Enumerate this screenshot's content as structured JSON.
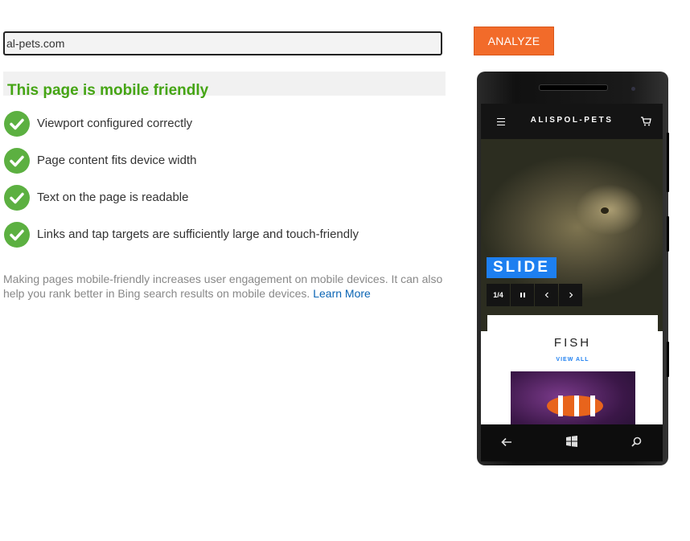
{
  "search": {
    "value": "al-pets.com"
  },
  "analyze_button": {
    "label": "ANALYZE"
  },
  "result": {
    "title": "This page is mobile friendly"
  },
  "checks": [
    "Viewport configured correctly",
    "Page content fits device width",
    "Text on the page is readable",
    "Links and tap targets are sufficiently large and touch-friendly"
  ],
  "note": {
    "text": "Making pages mobile-friendly increases user engagement on mobile devices. It can also help you rank better in Bing search results on mobile devices.",
    "link_label": "Learn More"
  },
  "preview": {
    "site_title": "ALISPOL-PETS",
    "slide_label": "SLIDE",
    "slide_counter": "1/4",
    "category_title": "FISH",
    "category_link": "VIEW ALL"
  },
  "colors": {
    "accent": "#f26b2a",
    "success": "#45a514",
    "check_bg": "#5cb041",
    "link": "#0a64b4",
    "slide_blue": "#1d7ff0"
  },
  "icons": [
    "check-icon",
    "menu-icon",
    "cart-icon",
    "pause-icon",
    "chevron-left-icon",
    "chevron-right-icon",
    "back-arrow-icon",
    "windows-logo-icon",
    "search-icon"
  ]
}
